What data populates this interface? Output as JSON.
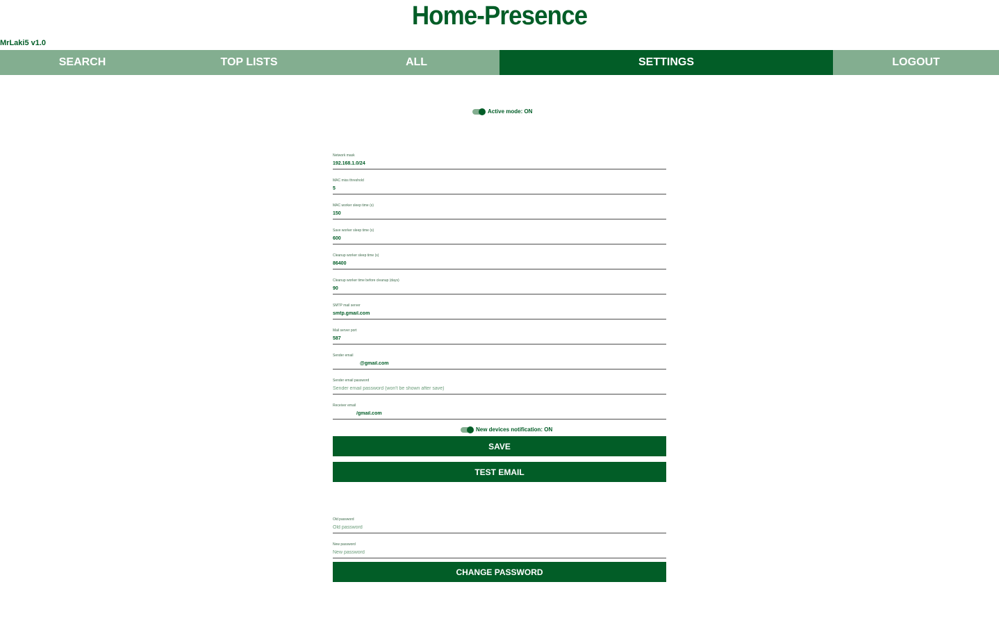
{
  "app": {
    "title": "Home-Presence",
    "user_label": "MrLaki5 v1.0"
  },
  "nav": {
    "items": [
      {
        "label": "SEARCH",
        "active": false
      },
      {
        "label": "TOP LISTS",
        "active": false
      },
      {
        "label": "ALL",
        "active": false
      },
      {
        "label": "SETTINGS",
        "active": true
      },
      {
        "label": "LOGOUT",
        "active": false
      }
    ]
  },
  "settings": {
    "active_mode_label": "Active mode: ON",
    "active_mode_on": true,
    "fields": [
      {
        "label": "Network mask",
        "value": "192.168.1.0/24",
        "placeholder": ""
      },
      {
        "label": "MAC miss threshold",
        "value": "5",
        "placeholder": ""
      },
      {
        "label": "MAC worker sleep time (s)",
        "value": "150",
        "placeholder": ""
      },
      {
        "label": "Save worker sleep time (s)",
        "value": "600",
        "placeholder": ""
      },
      {
        "label": "Cleanup worker sleep time (s)",
        "value": "86400",
        "placeholder": ""
      },
      {
        "label": "Cleanup worker time before cleanup (days)",
        "value": "90",
        "placeholder": ""
      },
      {
        "label": "SMTP mail server",
        "value": "smtp.gmail.com",
        "placeholder": ""
      },
      {
        "label": "Mail server port",
        "value": "587",
        "placeholder": ""
      },
      {
        "label": "Sender email",
        "value": "@gmail.com",
        "placeholder": ""
      },
      {
        "label": "Sender email password",
        "value": "",
        "placeholder": "Sender email password (won't be shown after save)"
      },
      {
        "label": "Receiver email",
        "value": "/gmail.com",
        "placeholder": ""
      }
    ],
    "notification_label": "New devices notification: ON",
    "notification_on": true,
    "save_label": "SAVE",
    "test_email_label": "TEST EMAIL"
  },
  "password": {
    "old_label": "Old password",
    "old_placeholder": "Old password",
    "new_label": "New password",
    "new_placeholder": "New password",
    "change_label": "CHANGE PASSWORD"
  },
  "colors": {
    "primary": "#025d27",
    "nav_bg": "#83ae90",
    "background": "#ffffff"
  }
}
